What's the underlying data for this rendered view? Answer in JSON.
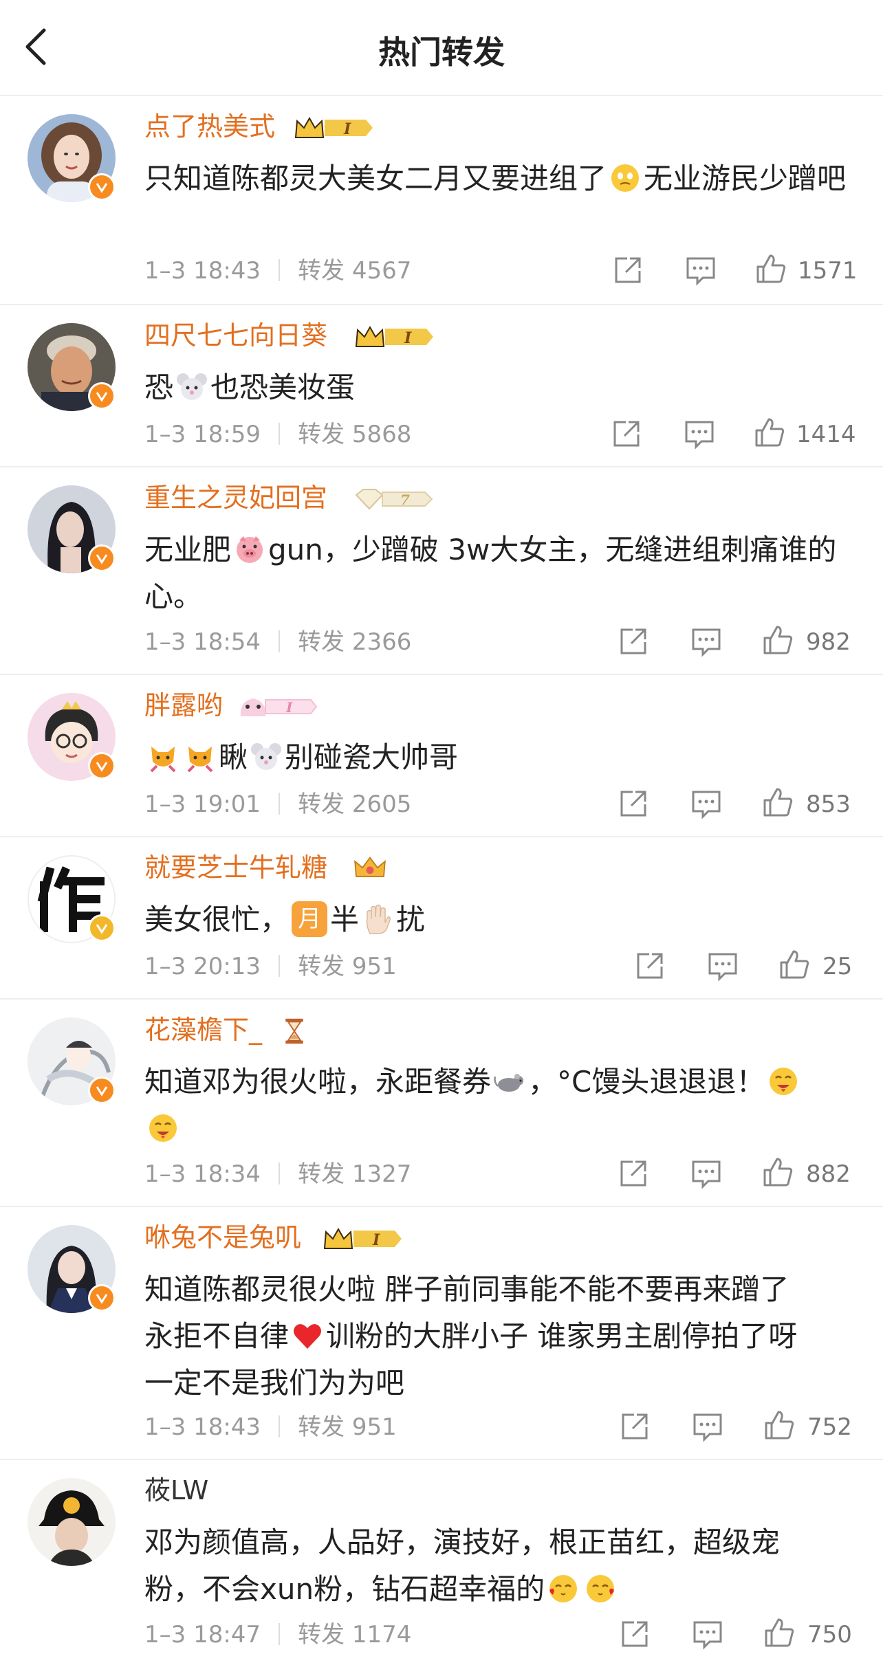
{
  "header": {
    "title": "热门转发"
  },
  "posts": [
    {
      "username": "点了热美式",
      "badge": "I",
      "text": [
        "只知道陈都灵大美女二月又要进组了",
        "无业游民少蹭吧"
      ],
      "time": "1–3 18:43",
      "repost_label": "转发",
      "reposts": "4567",
      "likes": "1571",
      "avatar_icon": "woman-portrait-avatar",
      "badge_icon": "crown-member-badge"
    },
    {
      "username": "四尺七七向日葵",
      "badge": "I",
      "text": [
        "恐",
        "也恐美妆蛋"
      ],
      "time": "1–3 18:59",
      "repost_label": "转发",
      "reposts": "5868",
      "likes": "1414",
      "avatar_icon": "man-portrait-avatar",
      "badge_icon": "crown-member-badge"
    },
    {
      "username": "重生之灵妃回宫",
      "badge": "7",
      "text": [
        "无业肥",
        "gun，少蹭破 3w大女主，无缝进组刺痛谁的心。"
      ],
      "time": "1–3 18:54",
      "repost_label": "转发",
      "reposts": "2366",
      "likes": "982",
      "avatar_icon": "dark-hair-portrait-avatar",
      "badge_icon": "diamond-member-badge"
    },
    {
      "username": "胖露哟",
      "badge": "I",
      "text": [
        "瞅",
        "别碰瓷大帅哥"
      ],
      "time": "1–3 19:01",
      "repost_label": "转发",
      "reposts": "2605",
      "likes": "853",
      "avatar_icon": "cartoon-boy-avatar",
      "badge_icon": "pink-member-badge"
    },
    {
      "username": "就要芝士牛轧糖",
      "badge": "",
      "text": [
        "美女很忙，",
        "月",
        "半",
        "扰"
      ],
      "time": "1–3 20:13",
      "repost_label": "转发",
      "reposts": "951",
      "likes": "25",
      "avatar_icon": "calligraphy-zuo-avatar",
      "badge_icon": "small-crown-badge"
    },
    {
      "username": "花藻檐下_",
      "badge": "",
      "text": [
        "知道邓为很火啦，永距餐券",
        "，°C馒头退退退！"
      ],
      "time": "1–3 18:34",
      "repost_label": "转发",
      "reposts": "1327",
      "likes": "882",
      "avatar_icon": "illustration-avatar",
      "badge_icon": "hourglass-icon"
    },
    {
      "username": "咻兔不是兔叽",
      "badge": "I",
      "text": [
        "知道陈都灵很火啦 胖子前同事能不能不要再来蹭了",
        "永拒不自律",
        "训粉的大胖小子 谁家男主剧停拍了呀",
        "一定不是我们为为吧"
      ],
      "time": "1–3 18:43",
      "repost_label": "转发",
      "reposts": "951",
      "likes": "752",
      "avatar_icon": "uniform-girl-avatar",
      "badge_icon": "crown-member-badge"
    },
    {
      "username": "莜LW",
      "badge": "",
      "text": [
        "邓为颜值高，人品好，演技好，根正苗红，超级宠",
        "粉，不会xun粉，钻石超幸福的"
      ],
      "time": "1–3 18:47",
      "repost_label": "转发",
      "reposts": "1174",
      "likes": "750",
      "avatar_icon": "bucket-hat-avatar",
      "badge_icon": ""
    }
  ]
}
